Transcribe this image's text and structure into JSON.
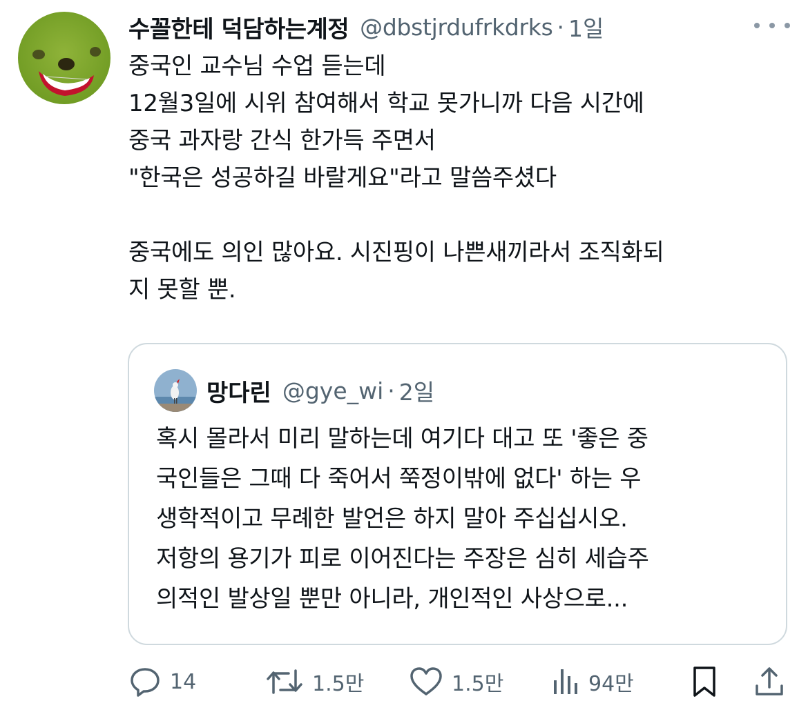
{
  "tweet": {
    "display_name": "수꼴한테 덕담하는계정",
    "handle": "@dbstjrdufrkdrks",
    "separator": "·",
    "time": "1일",
    "lines": [
      "중국인 교수님 수업 듣는데",
      "12월3일에 시위 참여해서 학교 못가니까 다음 시간에",
      "중국 과자랑 간식 한가득 주면서",
      "\"한국은 성공하길 바랄게요\"라고 말씀주셨다",
      "",
      "중국에도 의인 많아요. 시진핑이 나쁜새끼라서 조직화되",
      "지 못할 뿐."
    ]
  },
  "quoted": {
    "display_name": "망다린",
    "handle": "@gye_wi",
    "separator": "·",
    "time": "2일",
    "lines": [
      "혹시 몰라서 미리 말하는데 여기다 대고 또 '좋은 중",
      "국인들은 그때 다 죽어서 쭉정이밖에 없다' 하는 우",
      "생학적이고 무례한 발언은 하지 말아 주십십시오.",
      "저항의 용기가 피로 이어진다는 주장은 심히 세습주",
      "의적인 발상일 뿐만 아니라, 개인적인 사상으로..."
    ]
  },
  "actions": {
    "reply": {
      "icon": "reply-icon",
      "count": "14"
    },
    "retweet": {
      "icon": "retweet-icon",
      "count": "1.5만"
    },
    "like": {
      "icon": "heart-icon",
      "count": "1.5만"
    },
    "views": {
      "icon": "views-icon",
      "count": "94만"
    },
    "bookmark": {
      "icon": "bookmark-icon"
    },
    "share": {
      "icon": "share-icon"
    }
  },
  "colors": {
    "text": "#0f1419",
    "secondary": "#536471",
    "border": "#cfd9de"
  }
}
